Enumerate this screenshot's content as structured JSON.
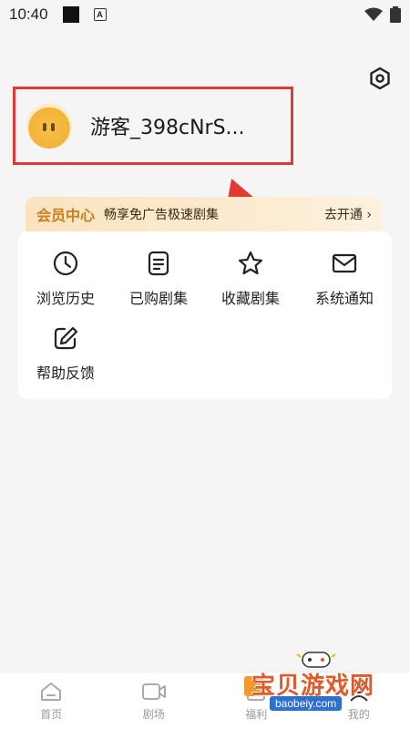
{
  "status_bar": {
    "time": "10:40",
    "a_label": "A"
  },
  "profile": {
    "username": "游客_398cNrS..."
  },
  "vip": {
    "title": "会员中心",
    "desc": "畅享免广告极速剧集",
    "action": "去开通"
  },
  "menu": {
    "items": [
      {
        "label": "浏览历史",
        "icon": "clock-icon"
      },
      {
        "label": "已购剧集",
        "icon": "document-icon"
      },
      {
        "label": "收藏剧集",
        "icon": "star-icon"
      },
      {
        "label": "系统通知",
        "icon": "mail-icon"
      },
      {
        "label": "帮助反馈",
        "icon": "edit-icon"
      }
    ]
  },
  "bottom_nav": {
    "items": [
      {
        "label": "首页",
        "icon": "home-icon"
      },
      {
        "label": "剧场",
        "icon": "video-icon"
      },
      {
        "label": "福利",
        "icon": "gift-icon"
      },
      {
        "label": "我的",
        "icon": "user-icon"
      }
    ]
  },
  "watermark": {
    "text": "宝贝游戏网",
    "url": "baobeiy.com"
  },
  "colors": {
    "accent_red": "#e23a33",
    "vip_gold": "#c9801f",
    "watermark_orange": "#e05a2a"
  }
}
